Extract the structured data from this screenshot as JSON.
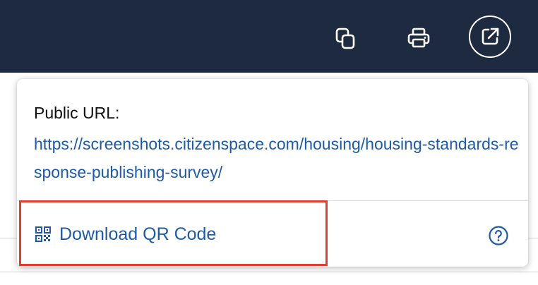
{
  "header": {
    "actions": [
      {
        "icon": "copy-icon",
        "label": "Copy"
      },
      {
        "icon": "print-icon",
        "label": "Print"
      },
      {
        "icon": "external-link-icon",
        "label": "Share"
      }
    ]
  },
  "popover": {
    "url_label": "Public URL:",
    "url": "https://screenshots.citizenspace.com/housing/housing-standards-response-publishing-survey/",
    "qr_label": "Download QR Code",
    "qr_icon": "qr-code-icon",
    "help_icon": "help-icon"
  },
  "colors": {
    "header_bg": "#1e2a40",
    "link": "#1f5aa6",
    "highlight": "#e0402a"
  }
}
